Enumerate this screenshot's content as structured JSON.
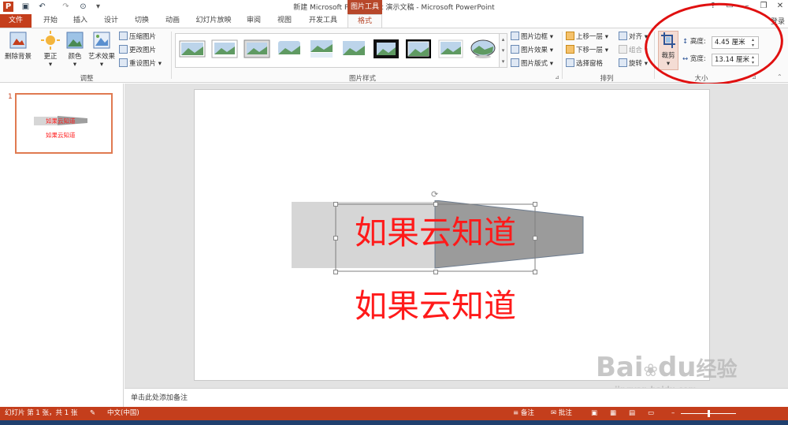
{
  "titlebar": {
    "title": "新建 Microsoft PowerPoint 演示文稿 - Microsoft PowerPoint",
    "context_tab": "图片工具",
    "help": "?",
    "minimize": "–",
    "restore": "❐",
    "close": "✕"
  },
  "tabs": [
    "文件",
    "开始",
    "插入",
    "设计",
    "切换",
    "动画",
    "幻灯片放映",
    "审阅",
    "视图",
    "开发工具",
    "格式"
  ],
  "login": "登录",
  "ribbon": {
    "adjust": {
      "remove_bg": "删除背景",
      "corrections": "更正",
      "color": "颜色",
      "artistic": "艺术效果",
      "compress": "压缩图片",
      "change": "更改图片",
      "reset": "重设图片",
      "group_label": "调整"
    },
    "styles": {
      "border": "图片边框",
      "effects": "图片效果",
      "layout": "图片版式",
      "group_label": "图片样式"
    },
    "arrange": {
      "bring_forward": "上移一层",
      "send_backward": "下移一层",
      "selection_pane": "选择窗格",
      "align": "对齐",
      "group": "组合",
      "rotate": "旋转",
      "group_label": "排列"
    },
    "size": {
      "crop": "裁剪",
      "height_label": "高度:",
      "height_value": "4.45 厘米",
      "width_label": "宽度:",
      "width_value": "13.14 厘米",
      "group_label": "大小"
    }
  },
  "slide_pane": {
    "slide_number": "1",
    "thumb_text_1": "如果云知道",
    "thumb_text_2": "如果云知道"
  },
  "slide": {
    "text_in_shape": "如果云知道",
    "text_below": "如果云知道"
  },
  "notes_placeholder": "单击此处添加备注",
  "statusbar": {
    "slide_info": "幻灯片 第 1 张，共 1 张",
    "language": "中文(中国)",
    "notes": "备注",
    "comments": "批注"
  },
  "watermark": {
    "brand": "Bai",
    "brand2": "du",
    "jingyan": "经验",
    "url": "jingyan.baidu.com"
  },
  "colors": {
    "accent": "#c43e1c",
    "text_red": "#ff1a1a",
    "annotation": "#e01010"
  }
}
